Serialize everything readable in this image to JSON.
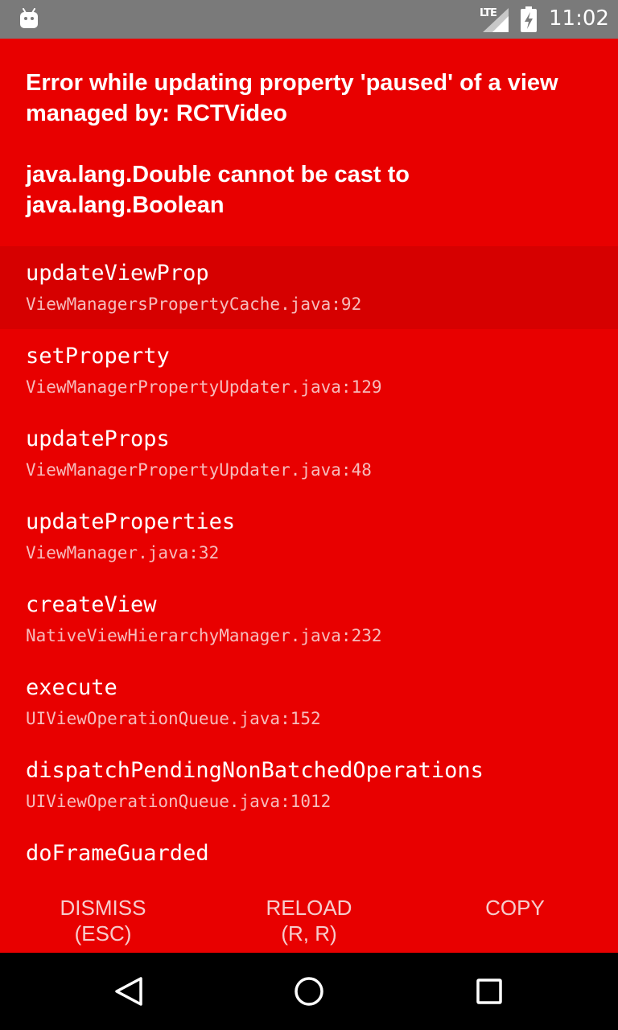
{
  "status_bar": {
    "network": "LTE",
    "time": "11:02",
    "icons": [
      "android-icon",
      "signal-icon",
      "battery-charging-icon"
    ]
  },
  "error": {
    "title_line1": "Error while updating property 'paused' of a view managed by: RCTVideo",
    "title_line2": "java.lang.Double cannot be cast to java.lang.Boolean"
  },
  "stack": [
    {
      "method": "updateViewProp",
      "location": "ViewManagersPropertyCache.java:92"
    },
    {
      "method": "setProperty",
      "location": "ViewManagerPropertyUpdater.java:129"
    },
    {
      "method": "updateProps",
      "location": "ViewManagerPropertyUpdater.java:48"
    },
    {
      "method": "updateProperties",
      "location": "ViewManager.java:32"
    },
    {
      "method": "createView",
      "location": "NativeViewHierarchyManager.java:232"
    },
    {
      "method": "execute",
      "location": "UIViewOperationQueue.java:152"
    },
    {
      "method": "dispatchPendingNonBatchedOperations",
      "location": "UIViewOperationQueue.java:1012"
    },
    {
      "method": "doFrameGuarded",
      "location": ""
    }
  ],
  "buttons": {
    "dismiss_line1": "DISMISS",
    "dismiss_line2": "(ESC)",
    "reload_line1": "RELOAD",
    "reload_line2": "(R, R)",
    "copy_label": "COPY"
  },
  "nav": {
    "icons": [
      "back-triangle-icon",
      "home-circle-icon",
      "recents-square-icon"
    ]
  },
  "colors": {
    "background": "#e80000",
    "selected_row": "#d60000",
    "status_bar": "#7a7a7a",
    "nav_bar": "#000000",
    "location_text": "#f6bcbc"
  }
}
